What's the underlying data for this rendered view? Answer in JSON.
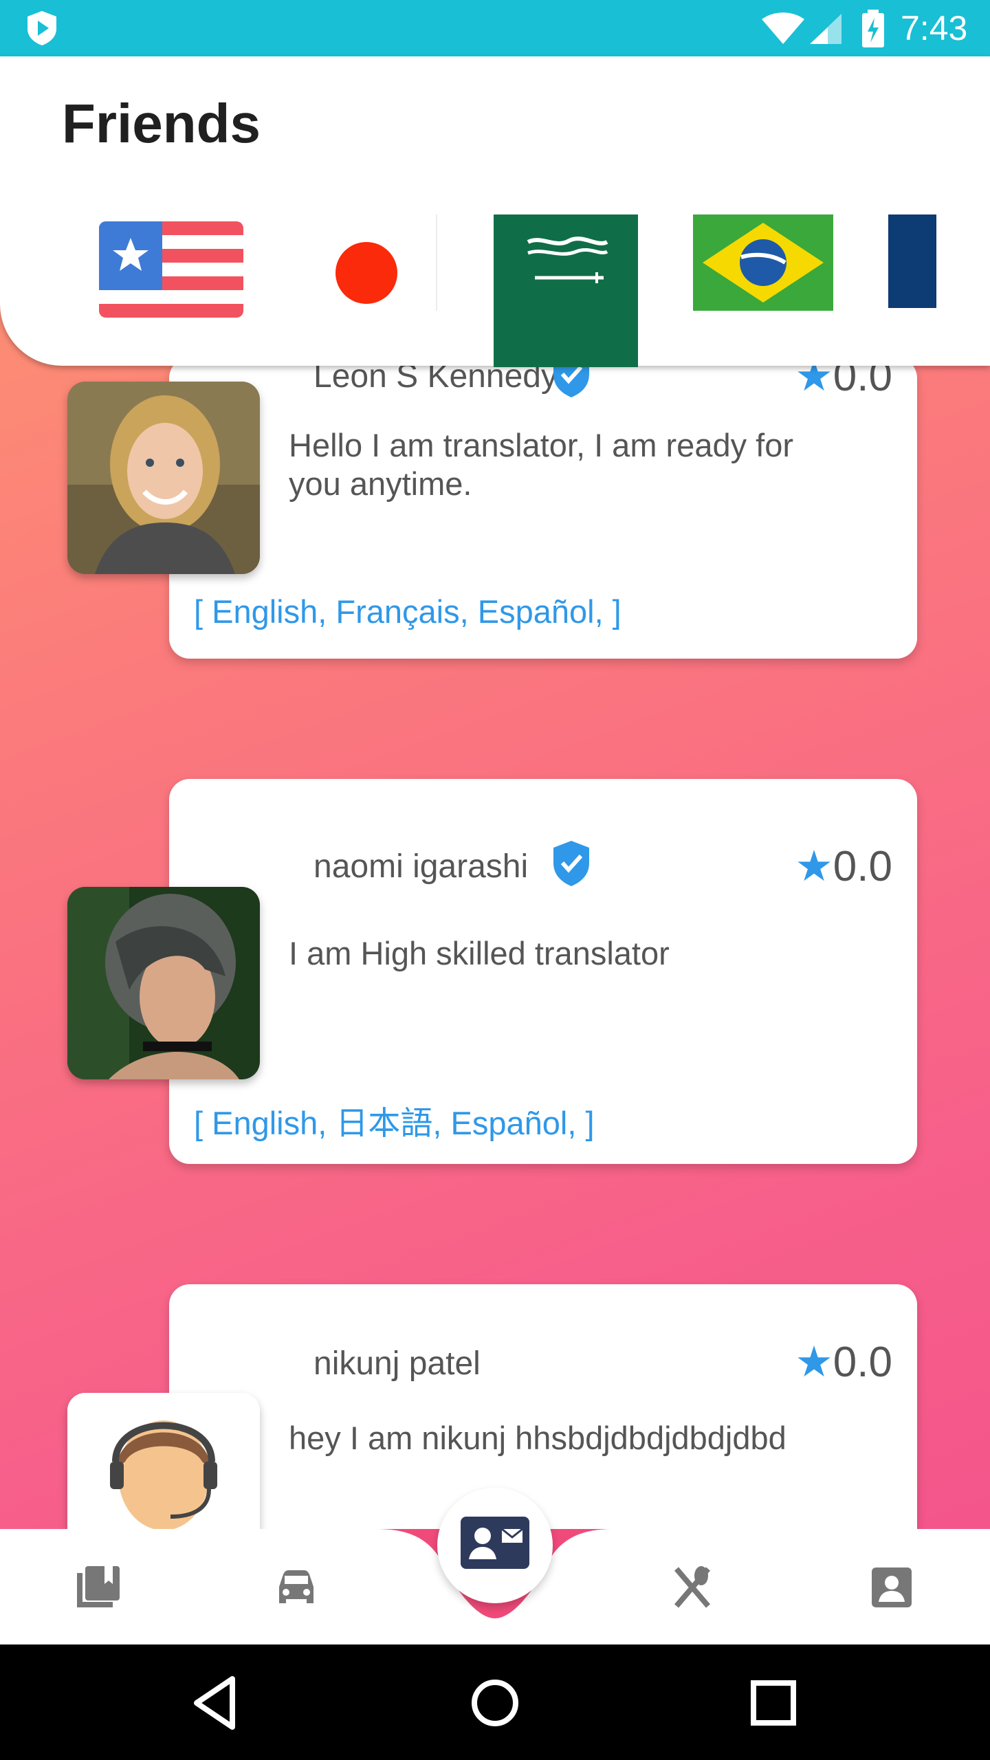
{
  "status_bar": {
    "time": "7:43",
    "icons": [
      "app-shield-icon",
      "wifi-icon",
      "cell-signal-icon",
      "battery-charging-icon"
    ]
  },
  "header": {
    "title": "Friends",
    "flags": [
      "us-flag",
      "japan-flag",
      "saudi-arabia-flag",
      "brazil-flag",
      "france-flag"
    ]
  },
  "cards": [
    {
      "name": "Leon S Kennedy",
      "rating": "0.0",
      "bio": "Hello I am translator, I am ready for you anytime.",
      "languages": "[ English, Français, Español, ]",
      "verified": true
    },
    {
      "name": "naomi igarashi",
      "rating": "0.0",
      "bio": "I am High skilled translator",
      "languages": "[ English, 日本語, Español, ]",
      "verified": true
    },
    {
      "name": "nikunj patel",
      "rating": "0.0",
      "bio": "hey I am nikunj hhsbdjdbdjdbdjdbd",
      "languages": "",
      "verified": false
    }
  ],
  "bottom_nav": {
    "items": [
      "library-icon",
      "car-icon",
      "contact-card-icon",
      "restaurant-icon",
      "profile-icon"
    ],
    "active": "contact-card-icon",
    "accent": "#f04a7a"
  },
  "colors": {
    "status_bar": "#19bfd4",
    "accent_blue": "#2f98e8",
    "gradient_start": "#fd9a6e",
    "gradient_end": "#f2508c"
  }
}
